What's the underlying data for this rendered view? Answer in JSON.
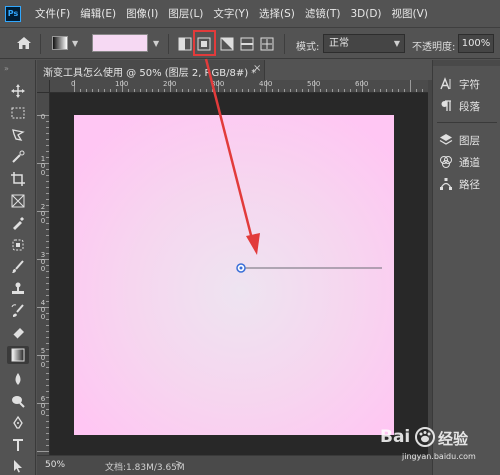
{
  "app": {
    "logo": "Ps"
  },
  "menu": [
    "文件(F)",
    "编辑(E)",
    "图像(I)",
    "图层(L)",
    "文字(Y)",
    "选择(S)",
    "滤镜(T)",
    "3D(D)",
    "视图(V)"
  ],
  "options": {
    "gradient_color": "#f6d9f3",
    "gradient_types": [
      "linear-gradient-icon",
      "radial-gradient-icon",
      "angle-gradient-icon",
      "reflected-gradient-icon",
      "diamond-gradient-icon"
    ],
    "selected_type": "radial-gradient-icon",
    "mode_label": "模式:",
    "mode_value": "正常",
    "opacity_label": "不透明度:",
    "opacity_value": "100%"
  },
  "document": {
    "tab_title": "渐变工具怎么使用 @ 50% (图层 2, RGB/8#) *",
    "close": "×"
  },
  "rulers": {
    "top": [
      "0",
      "100",
      "200",
      "300",
      "400",
      "500",
      "600"
    ],
    "left": [
      "0",
      "1 0 0",
      "2 0 0",
      "3 0 0",
      "4 0 0",
      "5 0 0",
      "6 0 0"
    ]
  },
  "status": {
    "zoom": "50%",
    "doc_info": "文档:1.83M/3.65M",
    "arrow": ">"
  },
  "panel": {
    "items": [
      {
        "icon": "character-icon",
        "label": "字符"
      },
      {
        "icon": "paragraph-icon",
        "label": "段落"
      },
      {
        "icon": "layers-icon",
        "label": "图层"
      },
      {
        "icon": "channels-icon",
        "label": "通道"
      },
      {
        "icon": "paths-icon",
        "label": "路径"
      }
    ]
  },
  "canvas": {
    "gradient_center": "#eee4f1",
    "gradient_edge": "#ffc6f3"
  },
  "annotation": {
    "highlight_color": "#e23b3b"
  },
  "watermark": {
    "text_1": "Bai",
    "text_2": "经验",
    "text_3": "jingyan.baidu.com"
  }
}
